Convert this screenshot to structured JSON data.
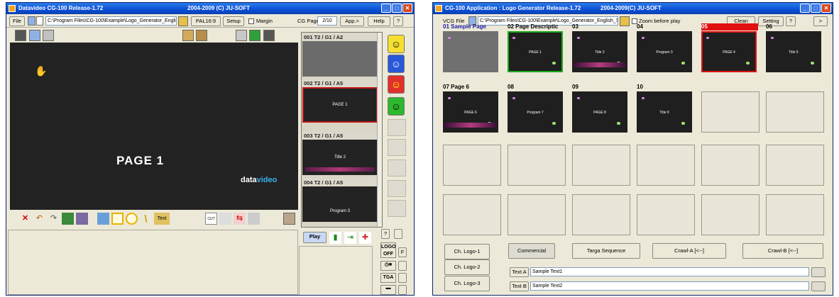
{
  "left": {
    "title": "Datavideo  CG-100  Release-1.72",
    "copyright": "2004-2009 (C) JU-SOFT",
    "menu": {
      "file": "File",
      "path": "C:\\Program Files\\CG-100\\Example\\Logo_Generator_English\\",
      "format": "PAL16:9",
      "setup": "Setup",
      "margin": "Margin",
      "cgpage_label": "CG Page",
      "cgpage_value": "2/10",
      "app": "App.>",
      "help": "Help",
      "help_q": "?"
    },
    "preview": {
      "page_label": "PAGE 1",
      "logo_main": "data",
      "logo_accent": "video"
    },
    "pages": [
      {
        "header": "001   T2 / G1 / A2",
        "title": ""
      },
      {
        "header": "002   T2 / G1 / A5",
        "title": "PAGE 1"
      },
      {
        "header": "003   T2 / G1 / A5",
        "title": "Title 2"
      },
      {
        "header": "004   T2 / G1 / A5",
        "title": "Program 3"
      }
    ],
    "play": "Play",
    "logo_off": "LOGO OFF",
    "logo_f": "F",
    "tga": "TGA",
    "q": "?"
  },
  "right": {
    "title": "CG-100 Application : Logo Generator    Release-1.72",
    "copyright": "2004-2009(C) JU-SOFT",
    "menu": {
      "vcg": "VCG File",
      "path": "C:\\Program Files\\CG-100\\Example\\Logo_Generator_English_S",
      "zoom": "Zoom before play",
      "clean": "Clean",
      "setting": "Setting",
      "q": "?",
      "arrow": ">"
    },
    "cells": [
      {
        "label": "01 Sample Page",
        "title": "",
        "border": "gray"
      },
      {
        "label": "02 Page Descriptic",
        "title": "PAGE 1",
        "border": "green"
      },
      {
        "label": "03",
        "title": "Title 2",
        "border": ""
      },
      {
        "label": "04",
        "title": "Program 3",
        "border": ""
      },
      {
        "label": "05",
        "title": "PAGE 4",
        "border": "red"
      },
      {
        "label": "06",
        "title": "Title 5",
        "border": ""
      },
      {
        "label": "07 Page 6",
        "title": "PAGE 6",
        "border": ""
      },
      {
        "label": "08",
        "title": "Program 7",
        "border": ""
      },
      {
        "label": "09",
        "title": "PAGE 8",
        "border": ""
      },
      {
        "label": "10",
        "title": "Title 9",
        "border": ""
      }
    ],
    "buttons": {
      "ch1": "Ch. Logo-1",
      "ch2": "Ch. Logo-2",
      "ch3": "Ch. Logo-3",
      "commercial": "Commercial",
      "targa": "Targa Sequence",
      "crawla": "Crawl-A  [<--]",
      "crawlb": "Crawl-B  [<--]",
      "texta_label": "Text A",
      "textb_label": "Text B"
    },
    "texta": "Sample Text1",
    "textb": "Sample Text2"
  }
}
